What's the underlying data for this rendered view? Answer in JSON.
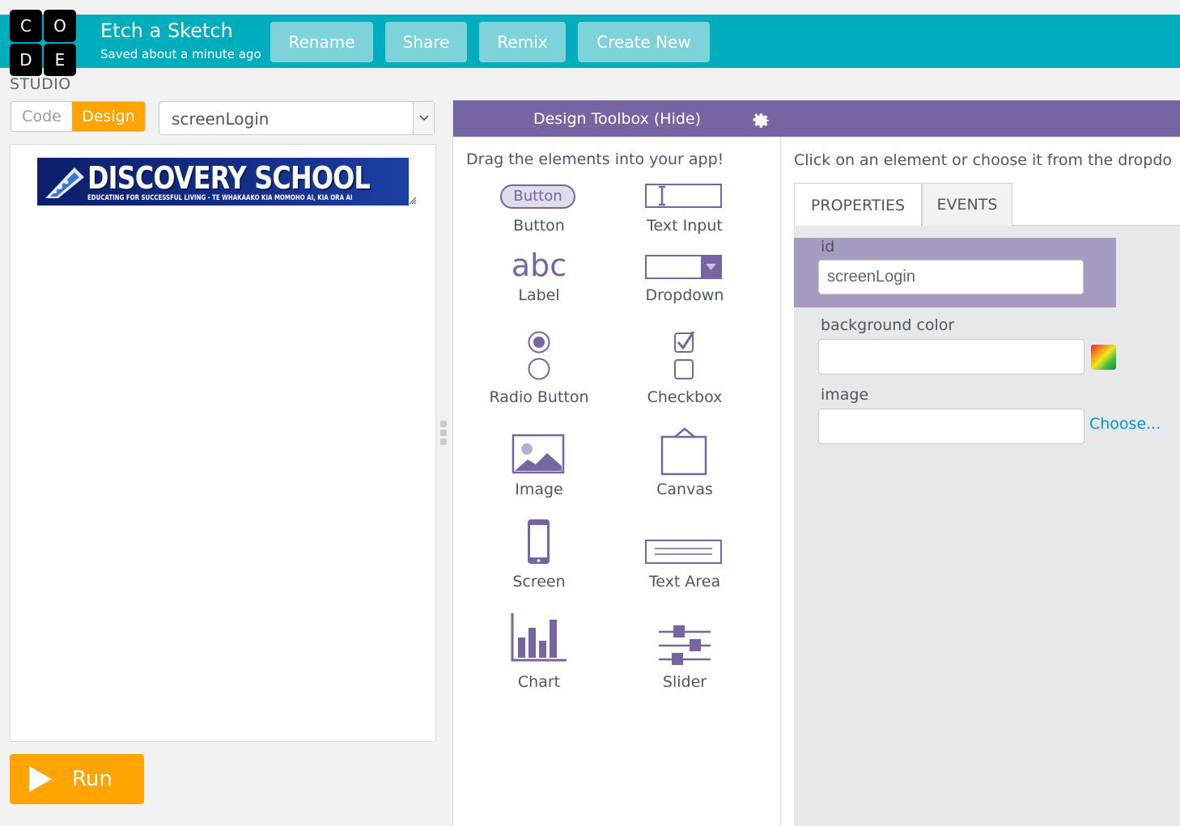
{
  "logo": {
    "letters": [
      "C",
      "O",
      "D",
      "E"
    ],
    "studio": "STUDIO"
  },
  "header": {
    "project_title": "Etch a Sketch",
    "saved_status": "Saved about a minute ago",
    "buttons": {
      "rename": "Rename",
      "share": "Share",
      "remix": "Remix",
      "create_new": "Create New"
    }
  },
  "mode_toggle": {
    "code": "Code",
    "design": "Design",
    "active": "Design"
  },
  "screen_select": {
    "value": "screenLogin"
  },
  "preview": {
    "banner_title": "DISCOVERY SCHOOL",
    "banner_subtitle": "EDUCATING FOR SUCCESSFUL LIVING - TE WHAKAAKO KIA MOMOHO AI, KIA ORA AI"
  },
  "run_button": {
    "label": "Run"
  },
  "toolbox": {
    "title": "Design Toolbox (Hide)",
    "hint": "Drag the elements into your app!",
    "button_preview": "Button",
    "items": [
      {
        "label": "Button",
        "icon": "button-icon"
      },
      {
        "label": "Text Input",
        "icon": "text-input-icon"
      },
      {
        "label": "Label",
        "icon": "label-icon",
        "glyph": "abc"
      },
      {
        "label": "Dropdown",
        "icon": "dropdown-icon"
      },
      {
        "label": "Radio Button",
        "icon": "radio-button-icon"
      },
      {
        "label": "Checkbox",
        "icon": "checkbox-icon"
      },
      {
        "label": "Image",
        "icon": "image-icon"
      },
      {
        "label": "Canvas",
        "icon": "canvas-icon"
      },
      {
        "label": "Screen",
        "icon": "screen-icon"
      },
      {
        "label": "Text Area",
        "icon": "text-area-icon"
      },
      {
        "label": "Chart",
        "icon": "chart-icon"
      },
      {
        "label": "Slider",
        "icon": "slider-icon"
      }
    ]
  },
  "properties": {
    "hint": "Click on an element or choose it from the dropdo",
    "tabs": [
      "PROPERTIES",
      "EVENTS"
    ],
    "active_tab": "PROPERTIES",
    "fields": {
      "id_label": "id",
      "id_value": "screenLogin",
      "background_color_label": "background color",
      "background_color_value": "",
      "image_label": "image",
      "image_value": "",
      "choose_link": "Choose..."
    }
  },
  "colors": {
    "header_teal": "#00adbc",
    "header_button": "#7ed3da",
    "accent_orange": "#ffa400",
    "toolbox_purple": "#7665a0",
    "selected_lavender": "#a69bc1",
    "link_blue": "#0094ca"
  }
}
